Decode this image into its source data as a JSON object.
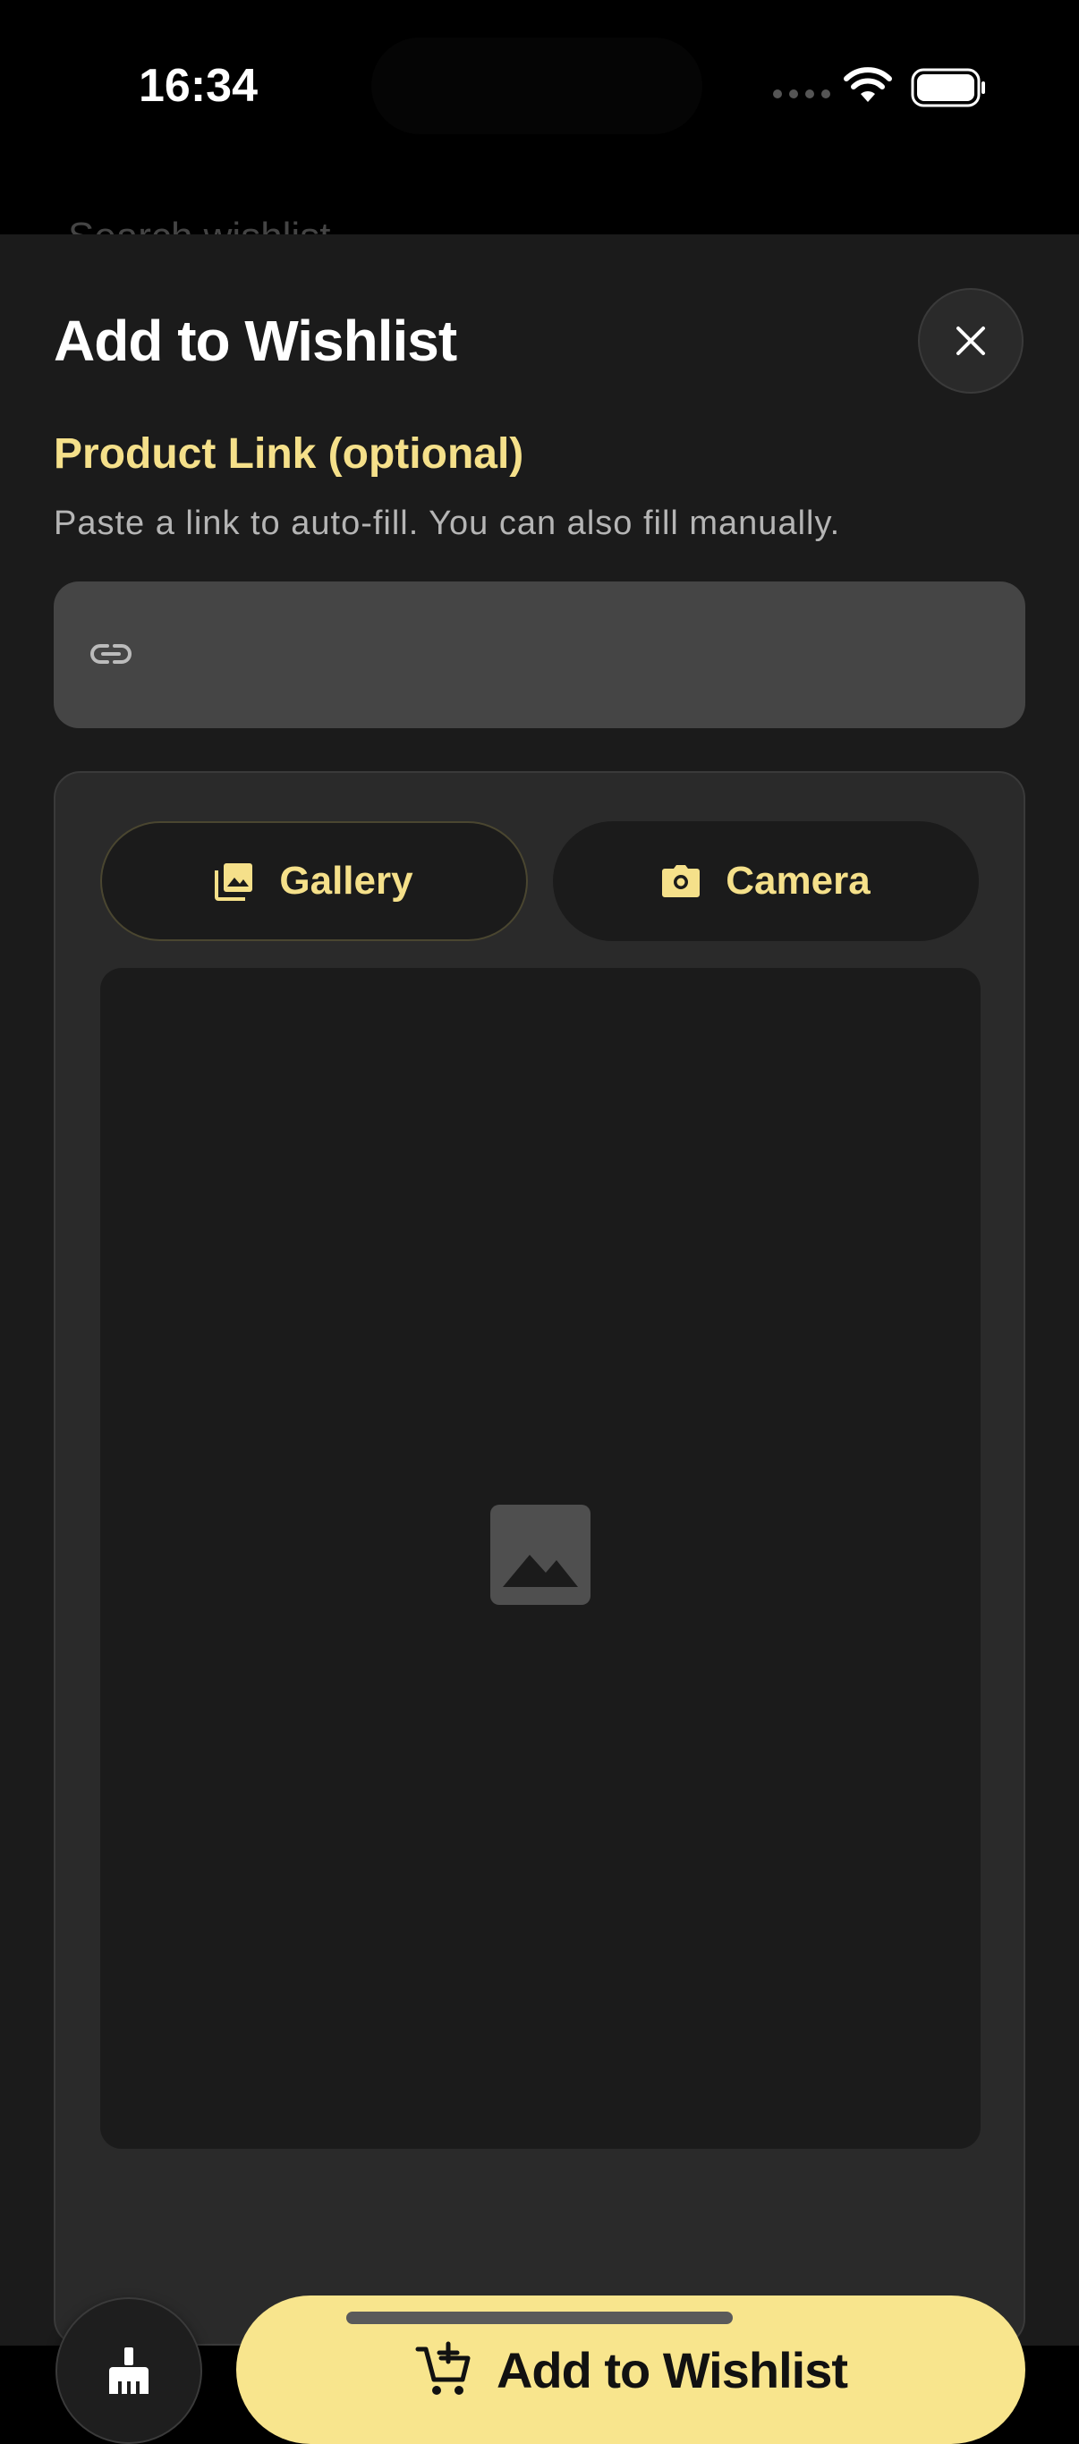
{
  "status_bar": {
    "time": "16:34"
  },
  "background": {
    "search_placeholder": "Search wishlist"
  },
  "sheet": {
    "title": "Add to Wishlist",
    "product_link": {
      "label": "Product Link (optional)",
      "hint": "Paste a link to auto-fill. You can also fill manually.",
      "value": "",
      "placeholder": ""
    },
    "image_picker": {
      "gallery_label": "Gallery",
      "camera_label": "Camera"
    },
    "footer": {
      "add_label": "Add to Wishlist"
    }
  },
  "colors": {
    "accent": "#F8E58D",
    "sheet_bg": "#1B1B1B",
    "card_bg": "#2A2A2A",
    "field_bg": "#454545"
  },
  "icons": [
    "close-icon",
    "link-icon",
    "gallery-icon",
    "camera-icon",
    "image-placeholder-icon",
    "broom-icon",
    "add-cart-icon"
  ]
}
